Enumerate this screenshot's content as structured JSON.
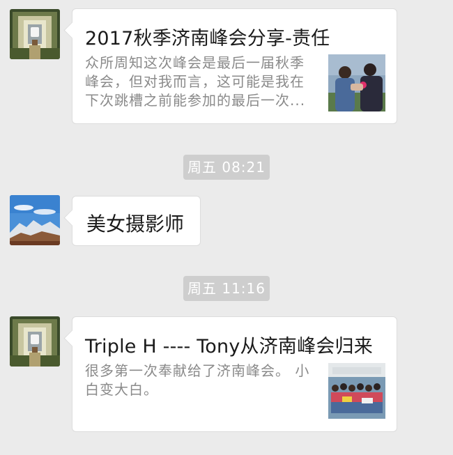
{
  "messages": [
    {
      "type": "article",
      "title": "2017秋季济南峰会分享-责任",
      "desc_lines": [
        "众所周知这次峰会是最后一届秋季",
        "峰会，但对我而言，这可能是我在",
        "下次跳槽之前能参加的最后一次..."
      ]
    },
    {
      "type": "timestamp",
      "text": "周五 08:21"
    },
    {
      "type": "text",
      "text": "美女摄影师"
    },
    {
      "type": "timestamp",
      "text": "周五 11:16"
    },
    {
      "type": "article",
      "title": "Triple H ---- Tony从济南峰会归来",
      "desc_lines": [
        "很多第一次奉献给了济南峰会。 小",
        "白变大白。"
      ]
    }
  ]
}
